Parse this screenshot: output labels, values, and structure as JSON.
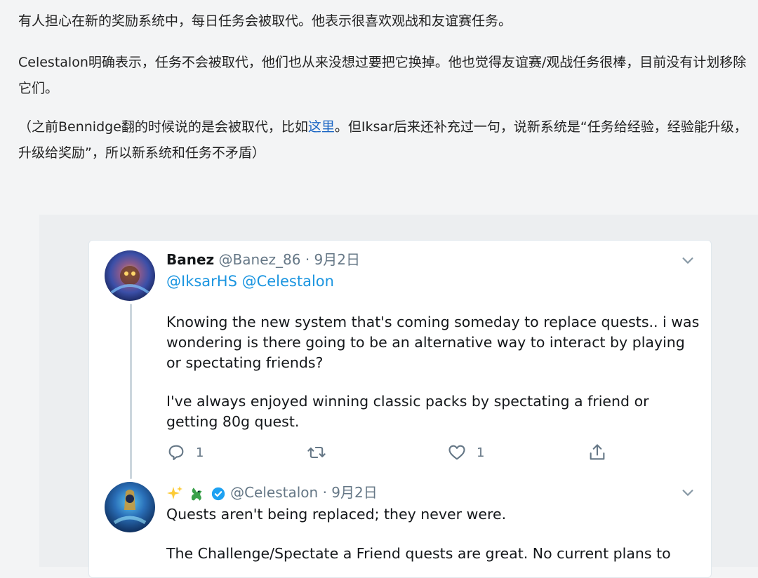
{
  "article": {
    "p1": "有人担心在新的奖励系统中，每日任务会被取代。他表示很喜欢观战和友谊赛任务。",
    "p2": "Celestalon明确表示，任务不会被取代，他们也从来没想过要把它换掉。他也觉得友谊赛/观战任务很棒，目前没有计划移除它们。",
    "p3_before": "（之前Bennidge翻的时候说的是会被取代，比如",
    "p3_link": "这里",
    "p3_after": "。但Iksar后来还补充过一句，说新系统是“任务给经验，经验能升级，升级给奖励”，所以新系统和任务不矛盾）"
  },
  "tweet1": {
    "name": "Banez",
    "handle": "@Banez_86",
    "sep": "·",
    "date": "9月2日",
    "mentions": "@IksarHS @Celestalon",
    "text1": "Knowing the new system that's coming someday to replace quests.. i was wondering is there going to be an alternative way to interact by playing or spectating friends?",
    "text2": "I've always enjoyed winning classic packs by spectating a friend or getting 80g quest.",
    "reply_count": "1",
    "like_count": "1"
  },
  "tweet2": {
    "handle": "@Celestalon",
    "sep": "·",
    "date": "9月2日",
    "text1": "Quests aren't being replaced; they never were.",
    "text2": "The Challenge/Spectate a Friend quests are great. No current plans to"
  },
  "colors": {
    "link": "#1a65c4",
    "twitter_blue": "#1b95e0",
    "muted": "#657786"
  },
  "icons": [
    "reply-icon",
    "retweet-icon",
    "like-icon",
    "share-icon",
    "chevron-down-icon",
    "sparkles-emoji",
    "dragon-emoji",
    "verified-badge-icon"
  ]
}
